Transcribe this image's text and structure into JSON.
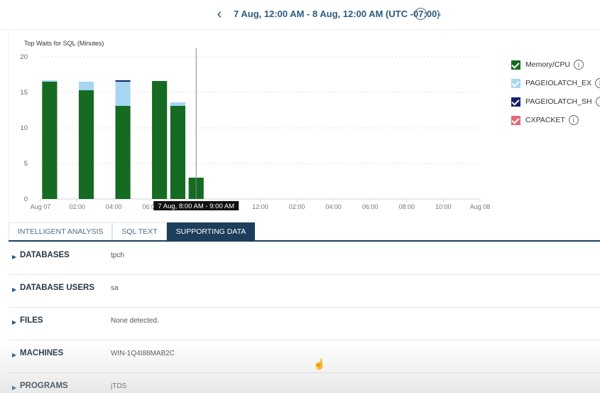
{
  "header": {
    "range_title": "7 Aug, 12:00 AM - 8 Aug, 12:00 AM (UTC -07:00)",
    "prev_icon": "chevron-left-icon",
    "next_icon": "chevron-right-icon",
    "refresh_icon": "refresh-icon"
  },
  "chart_data": {
    "type": "bar",
    "stacked": true,
    "title": "Top Waits for SQL (Minutes)",
    "xlabel": "",
    "ylabel": "",
    "ylim": [
      0,
      20
    ],
    "yticks": [
      0,
      5,
      10,
      15,
      20
    ],
    "x_tick_labels": [
      "Aug 07",
      "02:00",
      "04:00",
      "06:00",
      "08:00",
      "10:00",
      "12:00",
      "02:00",
      "04:00",
      "06:00",
      "08:00",
      "10:00",
      "Aug 08"
    ],
    "x_hour_range": [
      0,
      24
    ],
    "bar_hours": [
      0.5,
      2.5,
      4.5,
      6.5,
      7.5,
      8.5
    ],
    "series": [
      {
        "name": "Memory/CPU",
        "color": "#156b22",
        "values": [
          16.5,
          15.3,
          13.1,
          16.6,
          13.1,
          3.0
        ]
      },
      {
        "name": "PAGEIOLATCH_EX",
        "color": "#a7d6f2",
        "values": [
          0.2,
          1.2,
          3.4,
          0.0,
          0.5,
          0.0
        ]
      },
      {
        "name": "PAGEIOLATCH_SH",
        "color": "#15216b",
        "values": [
          0.0,
          0.0,
          0.2,
          0.0,
          0.0,
          0.0
        ]
      },
      {
        "name": "CXPACKET",
        "color": "#e06b77",
        "values": [
          0.0,
          0.0,
          0.0,
          0.0,
          0.0,
          0.0
        ]
      }
    ],
    "grid": true,
    "legend_position": "right",
    "hover_hour": 8.5,
    "tooltip": "7 Aug, 8:00 AM - 9:00 AM"
  },
  "tabs": [
    {
      "label": "INTELLIGENT ANALYSIS",
      "active": false
    },
    {
      "label": "SQL TEXT",
      "active": false
    },
    {
      "label": "SUPPORTING DATA",
      "active": true
    }
  ],
  "rows": [
    {
      "label": "DATABASES",
      "value": "tpch"
    },
    {
      "label": "DATABASE USERS",
      "value": "sa"
    },
    {
      "label": "FILES",
      "value": "None detected."
    },
    {
      "label": "MACHINES",
      "value": "WIN-1Q4I88MAB2C"
    },
    {
      "label": "PROGRAMS",
      "value": "jTDS"
    }
  ],
  "info_glyph": "i",
  "row_caret": "▶"
}
